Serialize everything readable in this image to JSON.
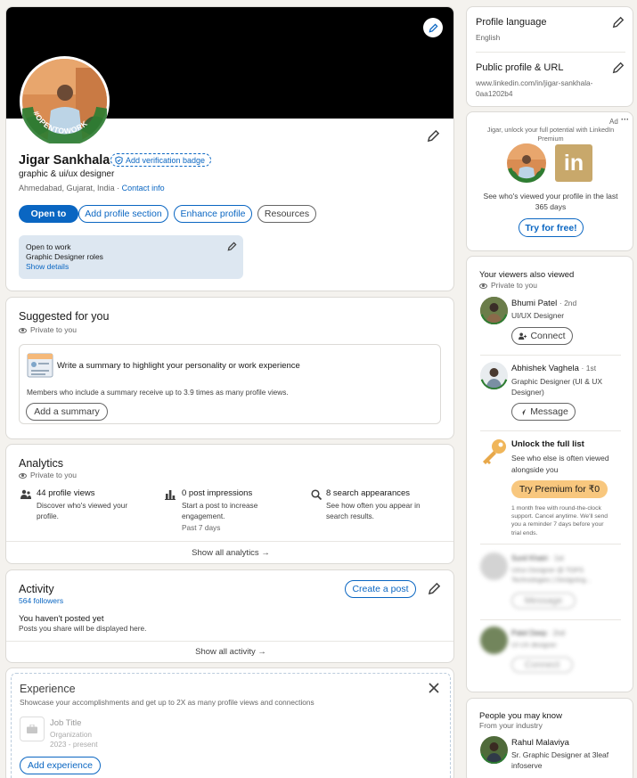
{
  "profile": {
    "name": "Jigar Sankhala",
    "verify_badge": "Add verification badge",
    "headline": "graphic & ui/ux designer",
    "location": "Ahmedabad, Gujarat, India",
    "separator": "·",
    "contact_info": "Contact info",
    "opentowork_text": "#OPENTOWORK",
    "buttons": {
      "open_to": "Open to",
      "add_section": "Add profile section",
      "enhance": "Enhance profile",
      "resources": "Resources"
    },
    "open_to_work": {
      "title": "Open to work",
      "roles": "Graphic Designer roles",
      "show_details": "Show details"
    }
  },
  "suggested": {
    "title": "Suggested for you",
    "privacy": "Private to you",
    "summary_title": "Write a summary to highlight your personality or work experience",
    "summary_desc": "Members who include a summary receive up to 3.9 times as many profile views.",
    "summary_button": "Add a summary"
  },
  "analytics": {
    "title": "Analytics",
    "privacy": "Private to you",
    "items": [
      {
        "title": "44 profile views",
        "desc": "Discover who's viewed your profile.",
        "extra": ""
      },
      {
        "title": "0 post impressions",
        "desc": "Start a post to increase engagement.",
        "extra": "Past 7 days"
      },
      {
        "title": "8 search appearances",
        "desc": "See how often you appear in search results.",
        "extra": ""
      }
    ],
    "show_all": "Show all analytics →"
  },
  "activity": {
    "title": "Activity",
    "followers": "564 followers",
    "create_post": "Create a post",
    "empty_title": "You haven't posted yet",
    "empty_desc": "Posts you share will be displayed here.",
    "show_all": "Show all activity →"
  },
  "experience": {
    "title": "Experience",
    "desc": "Showcase your accomplishments and get up to 2X as many profile views and connections",
    "job_title": "Job Title",
    "organization": "Organization",
    "dates": "2023 - present",
    "add_button": "Add experience"
  },
  "sidebar": {
    "profile_language": {
      "title": "Profile language",
      "value": "English"
    },
    "public_profile": {
      "title": "Public profile & URL",
      "url_line1": "www.linkedin.com/in/jigar-sankhala-",
      "url_line2": "0aa1202b4"
    },
    "ad": {
      "label": "Ad",
      "more": "···",
      "tagline_line1": "Jigar, unlock your full potential with LinkedIn",
      "tagline_line2": "Premium",
      "logo_text": "in",
      "body_line1": "See who's viewed your profile in the last",
      "body_line2": "365 days",
      "button": "Try for free!"
    },
    "viewers": {
      "title": "Your viewers also viewed",
      "privacy": "Private to you",
      "people": [
        {
          "name": "Bhumi Patel",
          "degree": "· 2nd",
          "headline_line1": "UI/UX Designer",
          "headline_line2": "",
          "button": "Connect"
        },
        {
          "name": "Abhishek Vaghela",
          "degree": "· 1st",
          "headline_line1": "Graphic Designer (UI & UX",
          "headline_line2": "Designer)",
          "button": "Message"
        }
      ],
      "unlock": {
        "title": "Unlock the full list",
        "desc_line1": "See who else is often viewed",
        "desc_line2": "alongside you",
        "button": "Try Premium for ₹0",
        "fine_print": [
          "1 month free with round-the-clock",
          "support. Cancel anytime. We'll send",
          "you a reminder 7 days before your",
          "trial ends."
        ]
      },
      "blurred": [
        {
          "name": "Sunil Khatri",
          "degree": "· 1st",
          "headline_line1": "Ui/ux Designer @ TOPS",
          "headline_line2": "Technologies | Designing...",
          "button": "Message"
        },
        {
          "name": "Patel Deep",
          "degree": "· 2nd",
          "headline_line1": "UI UX designer",
          "headline_line2": "",
          "button": "Connect"
        }
      ]
    },
    "people_you_may_know": {
      "title": "People you may know",
      "subtitle": "From your industry",
      "person": {
        "name": "Rahul Malaviya",
        "headline_line1": "Sr. Graphic Designer at 3leaf",
        "headline_line2": "infoserve"
      }
    }
  },
  "colors": {
    "brand_blue": "#0a66c2",
    "opentowork_green": "#2e7d32",
    "premium_gold": "#f8c77e",
    "page_bg": "#f4f2ee"
  }
}
